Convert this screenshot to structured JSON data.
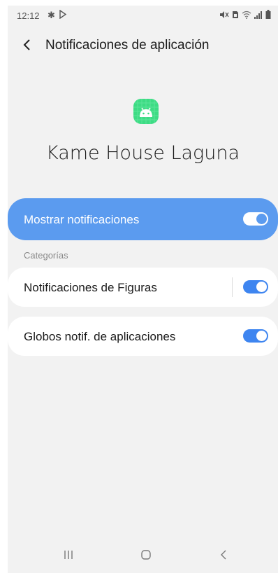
{
  "status_bar": {
    "time": "12:12",
    "icons": [
      "gear-icon",
      "play-icon",
      "mute-icon",
      "sim-icon",
      "wifi-icon",
      "signal-icon",
      "battery-icon"
    ]
  },
  "header": {
    "title": "Notificaciones de aplicación",
    "back_icon": "chevron-left-icon"
  },
  "app": {
    "name": "Kame House Laguna",
    "icon": "android-icon",
    "icon_color": "#3ddc84"
  },
  "main_toggle": {
    "label": "Mostrar notificaciones",
    "enabled": true,
    "accent": "#5b9bef"
  },
  "section": {
    "label": "Categorías"
  },
  "items": [
    {
      "label": "Notificaciones de Figuras",
      "enabled": true
    },
    {
      "label": "Globos notif. de aplicaciones",
      "enabled": true
    }
  ],
  "nav_bar": {
    "buttons": [
      "recents-icon",
      "home-icon",
      "back-icon"
    ]
  }
}
